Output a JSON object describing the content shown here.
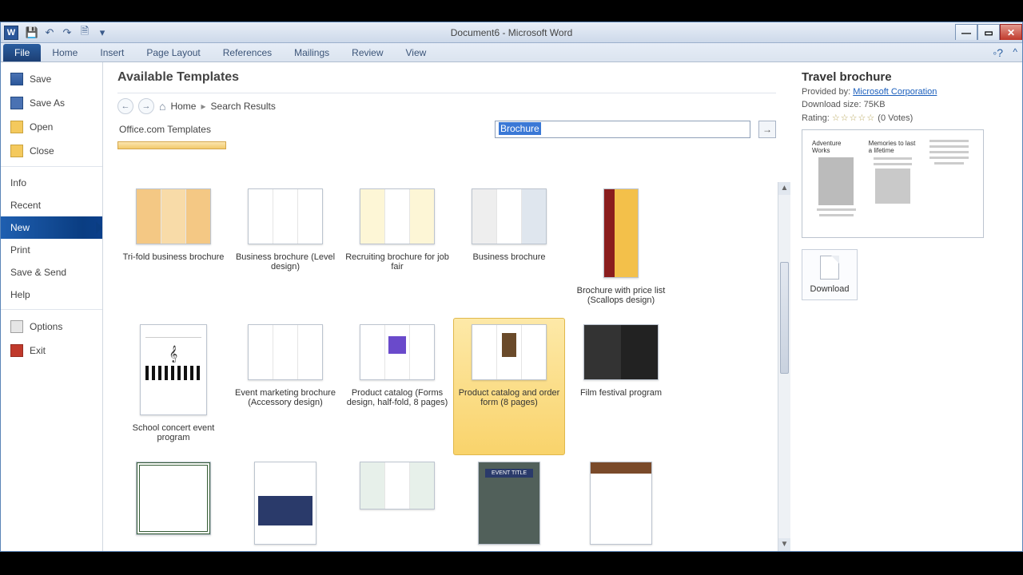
{
  "titlebar": {
    "title": "Document6 - Microsoft Word"
  },
  "ribbon": {
    "file": "File",
    "tabs": [
      "Home",
      "Insert",
      "Page Layout",
      "References",
      "Mailings",
      "Review",
      "View"
    ]
  },
  "backstage": {
    "items_icon": [
      {
        "label": "Save"
      },
      {
        "label": "Save As"
      },
      {
        "label": "Open"
      },
      {
        "label": "Close"
      }
    ],
    "items_plain": [
      {
        "label": "Info"
      },
      {
        "label": "Recent"
      },
      {
        "label": "New",
        "active": true
      },
      {
        "label": "Print"
      },
      {
        "label": "Save & Send"
      },
      {
        "label": "Help"
      }
    ],
    "items_bottom": [
      {
        "label": "Options"
      },
      {
        "label": "Exit"
      }
    ]
  },
  "templates": {
    "heading": "Available Templates",
    "breadcrumb_home": "Home",
    "breadcrumb_current": "Search Results",
    "provider_label": "Office.com Templates",
    "search_value": "Brochure",
    "items": [
      {
        "label": "Tri-fold business brochure",
        "shape": "landscape"
      },
      {
        "label": "Business brochure (Level design)",
        "shape": "landscape"
      },
      {
        "label": "Recruiting brochure for job fair",
        "shape": "landscape"
      },
      {
        "label": "Business brochure",
        "shape": "landscape"
      },
      {
        "label": "Brochure with price list (Scallops design)",
        "shape": "portrait"
      },
      {
        "label": "School concert event program",
        "shape": "wide"
      },
      {
        "label": "Event marketing brochure (Accessory design)",
        "shape": "landscape"
      },
      {
        "label": "Product catalog (Forms design, half-fold, 8 pages)",
        "shape": "landscape"
      },
      {
        "label": "Product catalog and order form (8 pages)",
        "shape": "landscape",
        "selected": true
      },
      {
        "label": "Film festival program",
        "shape": "landscape"
      },
      {
        "label": "",
        "shape": "square"
      },
      {
        "label": "",
        "shape": "tall"
      },
      {
        "label": "",
        "shape": "medium"
      },
      {
        "label": "",
        "shape": "tall"
      },
      {
        "label": "",
        "shape": "tall"
      }
    ]
  },
  "preview": {
    "title": "Travel brochure",
    "provided_by_label": "Provided by:",
    "provided_by_link": "Microsoft Corporation",
    "size_label": "Download size:",
    "size_value": "75KB",
    "rating_label": "Rating:",
    "votes": "(0 Votes)",
    "download": "Download",
    "thumb_h1": "Adventure Works",
    "thumb_h2": "Memories to last a lifetime"
  }
}
